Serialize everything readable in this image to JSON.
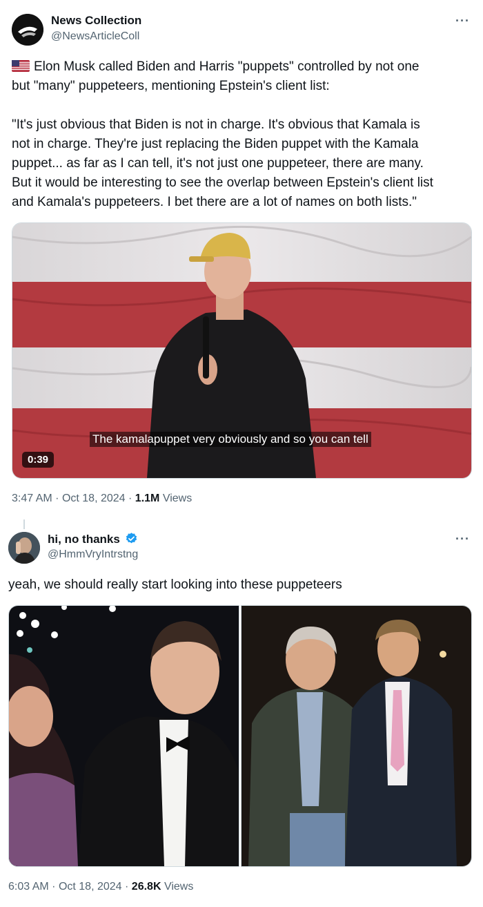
{
  "tweet1": {
    "name": "News Collection",
    "handle": "@NewsArticleColl",
    "flag": "🇺🇸",
    "lines": [
      "Elon Musk called Biden and Harris \"puppets\" controlled by not one",
      "but \"many\" puppeteers, mentioning Epstein's client list:",
      "",
      "\"It's just obvious that Biden is not in charge. It's obvious that Kamala is",
      "not in charge. They're just replacing the Biden puppet with the Kamala",
      "puppet... as far as I can tell, it's not just one puppeteer, there are many.",
      "But it would be interesting to see the overlap between Epstein's client list",
      "and Kamala's puppeteers. I bet there are a lot of names on both lists.\""
    ],
    "video_caption": "The kamalapuppet very obviously and so you can tell",
    "video_duration": "0:39",
    "time": "3:47 AM",
    "date": "Oct 18, 2024",
    "views_count": "1.1M",
    "views_label": "Views",
    "more": "···"
  },
  "tweet2": {
    "name": "hi, no thanks",
    "handle": "@HmmVryIntrstng",
    "text": "yeah, we should really start looking into these puppeteers",
    "time": "6:03 AM",
    "date": "Oct 18, 2024",
    "views_count": "26.8K",
    "views_label": "Views",
    "more": "···"
  },
  "separator": "·",
  "colors": {
    "text": "#0f1419",
    "secondary": "#536471",
    "verified": "#1d9bf0",
    "border": "#cfd9de"
  }
}
